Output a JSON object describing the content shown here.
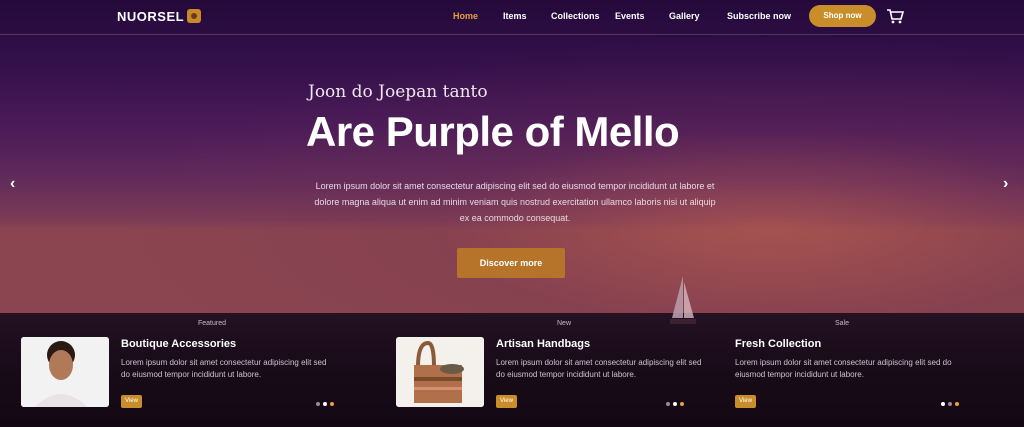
{
  "header": {
    "logo": "NUORSEL",
    "nav": [
      {
        "label": "Home",
        "active": true
      },
      {
        "label": "Items",
        "active": false
      },
      {
        "label": "Collections",
        "active": false
      },
      {
        "label": "Events",
        "active": false
      },
      {
        "label": "Gallery",
        "active": false
      },
      {
        "label": "Subscribe now",
        "active": false
      }
    ],
    "cta": "Shop now",
    "cart_icon": "cart-icon"
  },
  "hero": {
    "eyebrow": "Joon do Joepan tanto",
    "headline": "Are Purple of Mello",
    "description": "Lorem ipsum dolor sit amet consectetur adipiscing elit sed do eiusmod tempor incididunt ut labore et dolore magna aliqua ut enim ad minim veniam quis nostrud exercitation ullamco laboris nisi ut aliquip ex ea commodo consequat.",
    "button": "Discover more",
    "prev_icon": "chevron-left-icon",
    "next_icon": "chevron-right-icon"
  },
  "cards": [
    {
      "top_label": "Featured",
      "title": "Boutique Accessories",
      "text": "Lorem ipsum dolor sit amet consectetur adipiscing elit sed do eiusmod tempor incididunt ut labore.",
      "tag": "View"
    },
    {
      "top_label": "New",
      "title": "Artisan Handbags",
      "text": "Lorem ipsum dolor sit amet consectetur adipiscing elit sed do eiusmod tempor incididunt ut labore.",
      "tag": "View"
    },
    {
      "top_label": "Sale",
      "title": "Fresh Collection",
      "text": "Lorem ipsum dolor sit amet consectetur adipiscing elit sed do eiusmod tempor incididunt ut labore.",
      "tag": "View"
    }
  ],
  "colors": {
    "accent": "#c98e2a",
    "active_nav": "#e8a03a"
  }
}
